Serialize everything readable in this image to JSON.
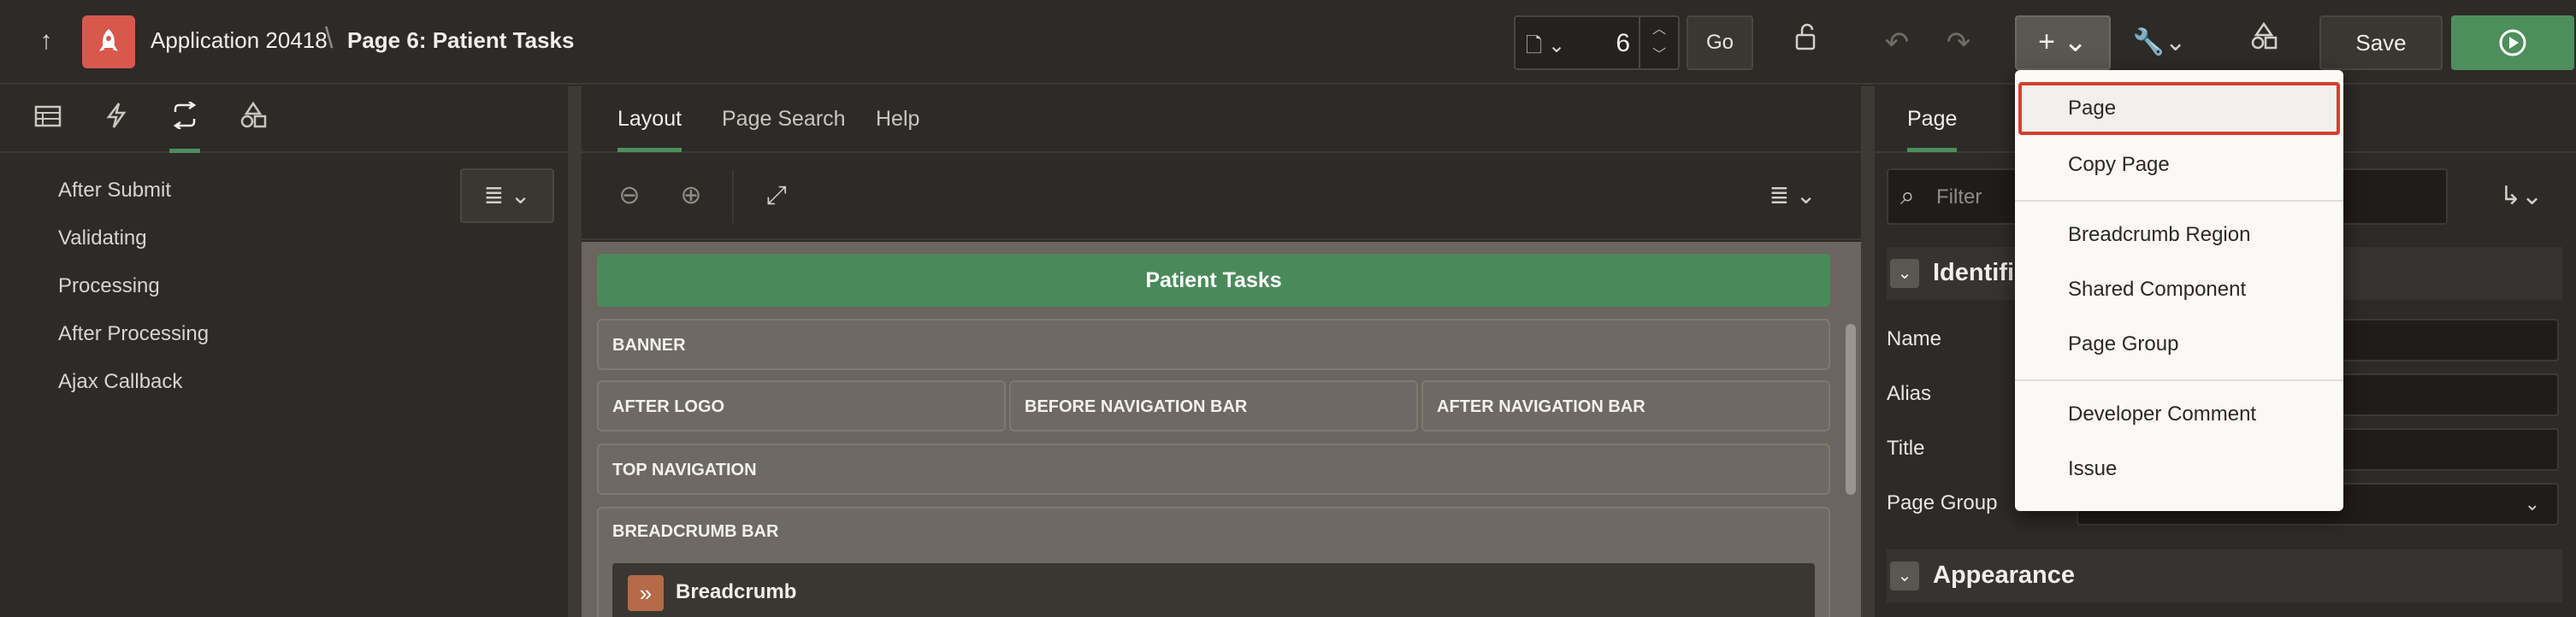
{
  "header": {
    "app_title": "Application 20418",
    "crumb_separator": "\\",
    "page_title": "Page 6: Patient Tasks",
    "page_number": "6",
    "go_label": "Go",
    "save_label": "Save"
  },
  "left_panel": {
    "tabs": [
      "rendering",
      "dynamic-actions",
      "processing",
      "shared-components"
    ],
    "active_tab": "processing",
    "items": [
      "After Submit",
      "Validating",
      "Processing",
      "After Processing",
      "Ajax Callback"
    ]
  },
  "center_panel": {
    "tabs": [
      "Layout",
      "Page Search",
      "Help"
    ],
    "active_tab": "Layout",
    "page_header": "Patient Tasks",
    "slots": {
      "banner": "BANNER",
      "after_logo": "AFTER LOGO",
      "before_nav": "BEFORE NAVIGATION BAR",
      "after_nav": "AFTER NAVIGATION BAR",
      "top_nav": "TOP NAVIGATION",
      "breadcrumb_bar": "BREADCRUMB BAR"
    },
    "breadcrumb_region": "Breadcrumb"
  },
  "right_panel": {
    "tab": "Page",
    "filter_placeholder": "Filter",
    "sections": {
      "identification": "Identification",
      "appearance": "Appearance"
    },
    "properties": {
      "name": "Name",
      "alias": "Alias",
      "title": "Title",
      "page_group": "Page Group"
    }
  },
  "create_menu": {
    "items": [
      {
        "label": "Page",
        "highlighted": true
      },
      {
        "label": "Copy Page"
      },
      {
        "label": "Breadcrumb Region"
      },
      {
        "label": "Shared Component"
      },
      {
        "label": "Page Group"
      },
      {
        "label": "Developer Comment"
      },
      {
        "label": "Issue"
      }
    ]
  },
  "colors": {
    "accent_green": "#4d8f5c",
    "app_icon": "#d8584e",
    "highlight_border": "#d43f2f"
  }
}
